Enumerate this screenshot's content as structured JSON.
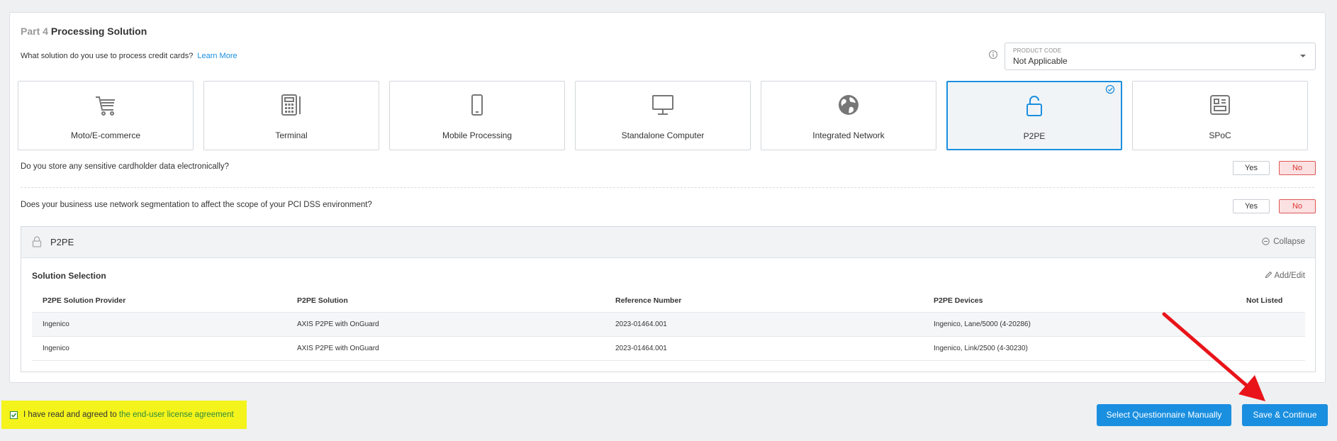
{
  "section": {
    "part": "Part 4",
    "title": "Processing Solution"
  },
  "question": {
    "text": "What solution do you use to process credit cards?",
    "learn_more": "Learn More"
  },
  "product_code": {
    "label": "PRODUCT CODE",
    "value": "Not Applicable"
  },
  "solutions": [
    {
      "label": "Moto/E-commerce",
      "icon": "cart-icon",
      "selected": false
    },
    {
      "label": "Terminal",
      "icon": "terminal-icon",
      "selected": false
    },
    {
      "label": "Mobile Processing",
      "icon": "mobile-icon",
      "selected": false
    },
    {
      "label": "Standalone Computer",
      "icon": "monitor-icon",
      "selected": false
    },
    {
      "label": "Integrated Network",
      "icon": "globe-icon",
      "selected": false
    },
    {
      "label": "P2PE",
      "icon": "unlock-icon",
      "selected": true
    },
    {
      "label": "SPoC",
      "icon": "spoc-device-icon",
      "selected": false
    }
  ],
  "questions": [
    {
      "text": "Do you store any sensitive cardholder data electronically?",
      "yes": "Yes",
      "no": "No",
      "answer": "No"
    },
    {
      "text": "Does your business use network segmentation to affect the scope of your PCI DSS environment?",
      "yes": "Yes",
      "no": "No",
      "answer": "No"
    }
  ],
  "p2pe_panel": {
    "title": "P2PE",
    "collapse": "Collapse",
    "subtitle": "Solution Selection",
    "add_edit": "Add/Edit",
    "columns": [
      "P2PE Solution Provider",
      "P2PE Solution",
      "Reference Number",
      "P2PE Devices",
      "Not Listed"
    ],
    "rows": [
      [
        "Ingenico",
        "AXIS P2PE with OnGuard",
        "2023-01464.001",
        "Ingenico, Lane/5000 (4-20286)",
        ""
      ],
      [
        "Ingenico",
        "AXIS P2PE with OnGuard",
        "2023-01464.001",
        "Ingenico, Link/2500 (4-30230)",
        ""
      ]
    ]
  },
  "agreement": {
    "prefix": "I have read and agreed to",
    "link": "the end-user license agreement",
    "checked": true
  },
  "buttons": {
    "select_manual": "Select Questionnaire Manually",
    "save_continue": "Save & Continue"
  },
  "colors": {
    "accent": "#1a8fe0",
    "no_selected": "#e05656",
    "highlight": "#f4f31b",
    "annotation_arrow": "#e8141a"
  }
}
